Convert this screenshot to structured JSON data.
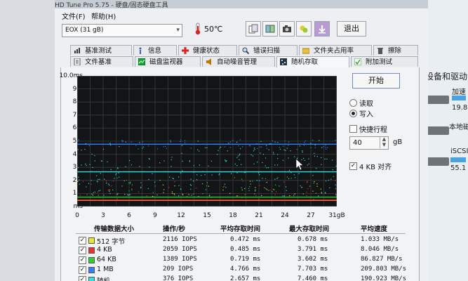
{
  "window": {
    "title": "HD Tune Pro 5.75 - 硬盘/固态硬盘工具"
  },
  "menu": {
    "items": [
      "文件(F)",
      "帮助(H)"
    ]
  },
  "toolbar": {
    "drive_selected": "EOX (31 gB)",
    "temperature": "50℃",
    "exit_label": "退出",
    "icons": [
      "copy-icon",
      "save-icon",
      "camera-icon",
      "options-icon",
      "download-icon"
    ]
  },
  "tabs_top": [
    "基准测试",
    "信息",
    "健康状态",
    "错误扫描",
    "文件夹占用率",
    "擦除"
  ],
  "tabs_bottom": [
    "文件基准",
    "磁盘监视器",
    "自动噪音管理",
    "随机存取",
    "附加测试"
  ],
  "active_tab": "随机存取",
  "chart": {
    "y_ticks": [
      "10.0ms",
      "9.0",
      "8.0",
      "7.0",
      "6.0",
      "5.0",
      "4.0",
      "3.0",
      "2.0",
      "1.0",
      "ms"
    ],
    "x_ticks": [
      "0",
      "3",
      "6",
      "9",
      "12",
      "15",
      "18",
      "21",
      "24",
      "27",
      "31gB"
    ]
  },
  "chart_data": {
    "type": "scatter",
    "xlabel": "",
    "ylabel": "",
    "xlim": [
      0,
      31
    ],
    "ylim": [
      0,
      10
    ],
    "x_unit": "gB",
    "y_unit": "ms",
    "series": [
      {
        "name": "512 字节",
        "color": "#e8e830",
        "y_level": 0.47
      },
      {
        "name": "4 KB",
        "color": "#ee3030",
        "y_level": 0.49
      },
      {
        "name": "64 KB",
        "color": "#30d030",
        "y_level": 0.72
      },
      {
        "name": "1 MB",
        "color": "#3080ff",
        "y_level": 4.77
      },
      {
        "name": "随机",
        "color": "#30e0e0",
        "y_level": 2.66
      }
    ],
    "grid": true
  },
  "controls": {
    "start_label": "开始",
    "read_label": "读取",
    "write_label": "写入",
    "selected_mode": "写入",
    "short_stroke_label": "快捷行程",
    "short_stroke_checked": false,
    "short_stroke_value": "40",
    "short_stroke_unit": "gB",
    "align_label": "4 KB 对齐",
    "align_checked": true
  },
  "table": {
    "headers": [
      "传输数据大小",
      "操作/秒",
      "平均存取时间",
      "最大存取时间",
      "平均速度"
    ],
    "rows": [
      {
        "size": "512 字节",
        "color": "#e8e830",
        "checked": true,
        "ops": "2116 IOPS",
        "avg": "0.472 ms",
        "max": "0.678 ms",
        "speed": "1.033 MB/s"
      },
      {
        "size": "4 KB",
        "color": "#ee3030",
        "checked": true,
        "ops": "2059 IOPS",
        "avg": "0.485 ms",
        "max": "3.791 ms",
        "speed": "8.046 MB/s"
      },
      {
        "size": "64 KB",
        "color": "#30d030",
        "checked": true,
        "ops": "1389 IOPS",
        "avg": "0.719 ms",
        "max": "3.602 ms",
        "speed": "86.827 MB/s"
      },
      {
        "size": "1 MB",
        "color": "#3080ff",
        "checked": true,
        "ops": "209 IOPS",
        "avg": "4.766 ms",
        "max": "7.703 ms",
        "speed": "209.803 MB/s"
      },
      {
        "size": "随机",
        "color": "#30e0e0",
        "checked": true,
        "ops": "376 IOPS",
        "avg": "2.657 ms",
        "max": "7.460 ms",
        "speed": "190.923 MB/s"
      }
    ]
  },
  "side_panel": {
    "heading": "设备和驱动",
    "items": [
      "加速",
      "19.8 G",
      "本地磁",
      "iSCSI-",
      "55.1 G"
    ]
  }
}
